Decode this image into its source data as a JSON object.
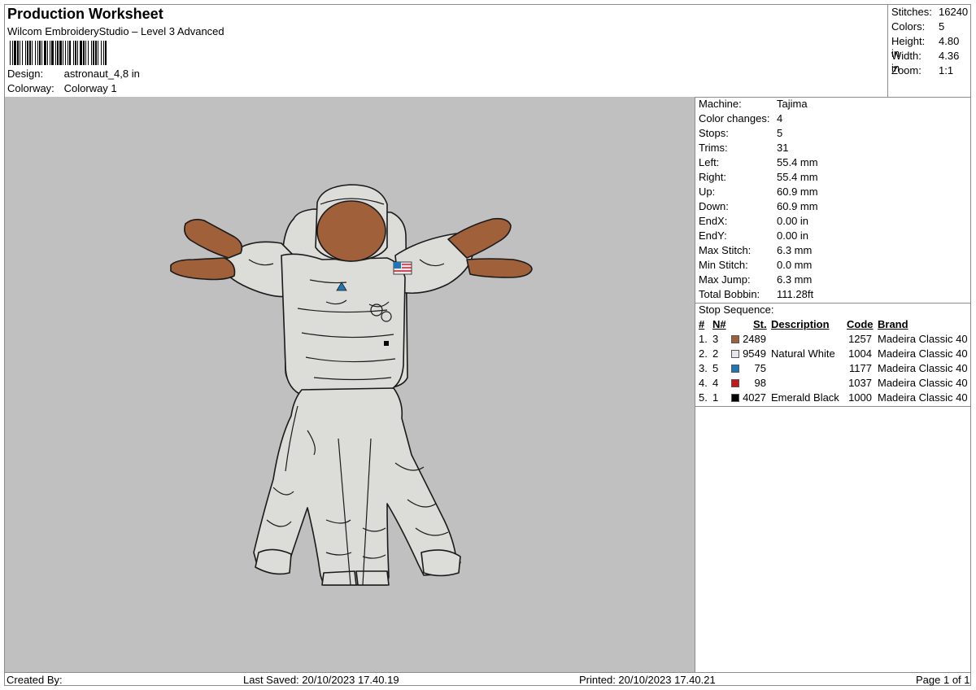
{
  "header": {
    "title": "Production Worksheet",
    "subtitle": "Wilcom EmbroideryStudio – Level 3 Advanced",
    "design_label": "Design:",
    "design_value": "astronaut_4,8 in",
    "colorway_label": "Colorway:",
    "colorway_value": "Colorway 1"
  },
  "summary": [
    {
      "label": "Stitches:",
      "value": "16240"
    },
    {
      "label": "Colors:",
      "value": "5"
    },
    {
      "label": "Height:",
      "value": "4.80 in"
    },
    {
      "label": "Width:",
      "value": "4.36 in"
    },
    {
      "label": "Zoom:",
      "value": "1:1"
    }
  ],
  "machine_info": [
    {
      "label": "Machine:",
      "value": "Tajima"
    },
    {
      "label": "Color changes:",
      "value": "4"
    },
    {
      "label": "Stops:",
      "value": "5"
    },
    {
      "label": "Trims:",
      "value": "31"
    },
    {
      "label": "Left:",
      "value": "55.4 mm"
    },
    {
      "label": "Right:",
      "value": "55.4 mm"
    },
    {
      "label": "Up:",
      "value": "60.9 mm"
    },
    {
      "label": "Down:",
      "value": "60.9 mm"
    },
    {
      "label": "EndX:",
      "value": "0.00 in"
    },
    {
      "label": "EndY:",
      "value": "0.00 in"
    },
    {
      "label": "Max Stitch:",
      "value": "6.3 mm"
    },
    {
      "label": "Min Stitch:",
      "value": "0.0 mm"
    },
    {
      "label": "Max Jump:",
      "value": "6.3 mm"
    },
    {
      "label": "Total Bobbin:",
      "value": "111.28ft"
    }
  ],
  "stop_sequence": {
    "title": "Stop Sequence:",
    "headers": {
      "num": "#",
      "n": "N#",
      "st": "St.",
      "desc": "Description",
      "code": "Code",
      "brand": "Brand"
    },
    "rows": [
      {
        "num": "1.",
        "n": "3",
        "color": "#a0603a",
        "st": "2489",
        "desc": "",
        "code": "1257",
        "brand": "Madeira Classic 40"
      },
      {
        "num": "2.",
        "n": "2",
        "color": "#e6e8ee",
        "st": "9549",
        "desc": "Natural White",
        "code": "1004",
        "brand": "Madeira Classic 40"
      },
      {
        "num": "3.",
        "n": "5",
        "color": "#1f78b4",
        "st": "75",
        "desc": "",
        "code": "1177",
        "brand": "Madeira Classic 40"
      },
      {
        "num": "4.",
        "n": "4",
        "color": "#c8161d",
        "st": "98",
        "desc": "",
        "code": "1037",
        "brand": "Madeira Classic 40"
      },
      {
        "num": "5.",
        "n": "1",
        "color": "#000000",
        "st": "4027",
        "desc": "Emerald Black",
        "code": "1000",
        "brand": "Madeira Classic 40"
      }
    ]
  },
  "footer": {
    "created_by": "Created By:",
    "last_saved": "Last Saved: 20/10/2023 17.40.19",
    "printed": "Printed: 20/10/2023 17.40.21",
    "page": "Page 1 of 1"
  },
  "colors": {
    "canvas_bg": "#c0c0c0",
    "suit": "#dcddd8",
    "gloves": "#a0603a",
    "outline": "#1a1a1a"
  }
}
